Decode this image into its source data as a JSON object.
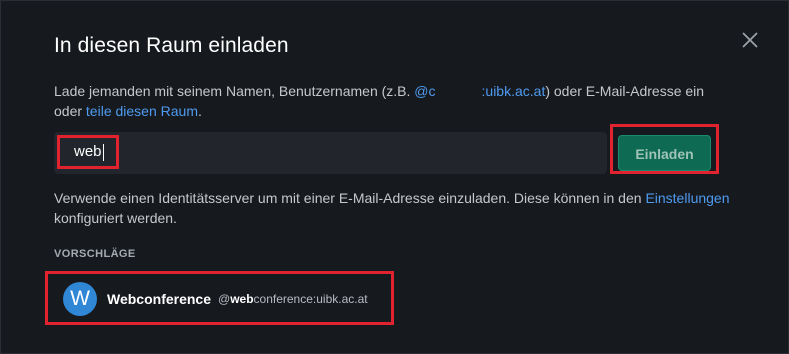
{
  "dialog": {
    "title": "In diesen Raum einladen",
    "description": {
      "part1": "Lade jemanden mit seinem Namen, Benutzernamen (z.B. ",
      "mxid_prefix": "@c",
      "mxid_suffix": ":uibk.ac.at",
      "part2": ") oder E-Mail-Adresse ein oder ",
      "share_link": "teile diesen Raum",
      "part3": "."
    },
    "input": {
      "pill_value": "web"
    },
    "invite_button": "Einladen",
    "info": {
      "text1": "Verwende einen Identitätsserver um mit einer E-Mail-Adresse einzuladen. Diese können in den ",
      "settings_link": "Einstellungen",
      "text2": " konfiguriert werden."
    },
    "suggestions": {
      "label": "VORSCHLÄGE",
      "items": [
        {
          "avatar_letter": "W",
          "name": "Webconference",
          "id_prefix": "@",
          "id_match": "web",
          "id_rest": "conference:uibk.ac.at"
        }
      ]
    }
  },
  "colors": {
    "background": "#16191e",
    "accent_link": "#4f9bf0",
    "invite_button": "#0f6a53",
    "highlight_outline": "#e0232e",
    "avatar": "#2f87d6"
  }
}
